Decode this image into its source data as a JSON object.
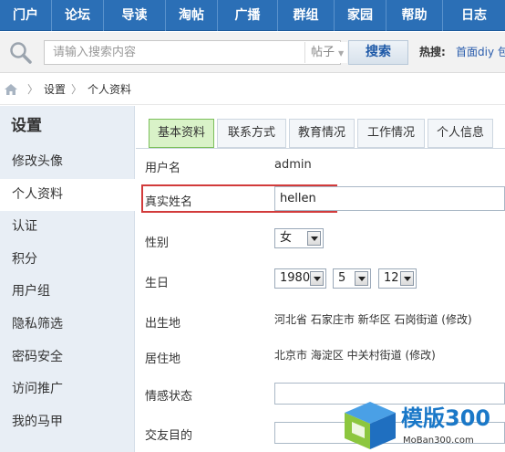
{
  "nav": {
    "items": [
      "门户",
      "论坛",
      "导读",
      "淘帖",
      "广播",
      "群组",
      "家园",
      "帮助",
      "日志"
    ]
  },
  "search": {
    "placeholder": "请输入搜索内容",
    "type_label": "帖子",
    "button_label": "搜索",
    "hot_label": "热搜:",
    "hot_link": "首面diy 包"
  },
  "breadcrumb": {
    "items": [
      "设置",
      "个人资料"
    ]
  },
  "sidebar": {
    "title": "设置",
    "items": [
      {
        "label": "修改头像",
        "active": false
      },
      {
        "label": "个人资料",
        "active": true
      },
      {
        "label": "认证",
        "active": false
      },
      {
        "label": "积分",
        "active": false
      },
      {
        "label": "用户组",
        "active": false
      },
      {
        "label": "隐私筛选",
        "active": false
      },
      {
        "label": "密码安全",
        "active": false
      },
      {
        "label": "访问推广",
        "active": false
      },
      {
        "label": "我的马甲",
        "active": false
      }
    ]
  },
  "tabs": [
    {
      "label": "基本资料",
      "active": true
    },
    {
      "label": "联系方式",
      "active": false
    },
    {
      "label": "教育情况",
      "active": false
    },
    {
      "label": "工作情况",
      "active": false
    },
    {
      "label": "个人信息",
      "active": false
    }
  ],
  "form": {
    "username_label": "用户名",
    "username_value": "admin",
    "realname_label": "真实姓名",
    "realname_value": "hellen",
    "gender_label": "性别",
    "gender_value": "女",
    "birthday_label": "生日",
    "birth_year": "1980",
    "birth_month": "5",
    "birth_day": "12",
    "birthplace_label": "出生地",
    "birthplace_value": "河北省 石家庄市 新华区 石岗街道 (修改)",
    "residence_label": "居住地",
    "residence_value": "北京市 海淀区 中关村街道 (修改)",
    "emotion_label": "情感状态",
    "purpose_label": "交友目的"
  },
  "watermark": {
    "brand": "模版300",
    "url": "MoBan300.com",
    "accent": "#1a78c8"
  },
  "colors": {
    "nav_bg": "#2b6fb6",
    "active_tab_bg": "#d9f2c8",
    "highlight": "#d23b3b"
  }
}
